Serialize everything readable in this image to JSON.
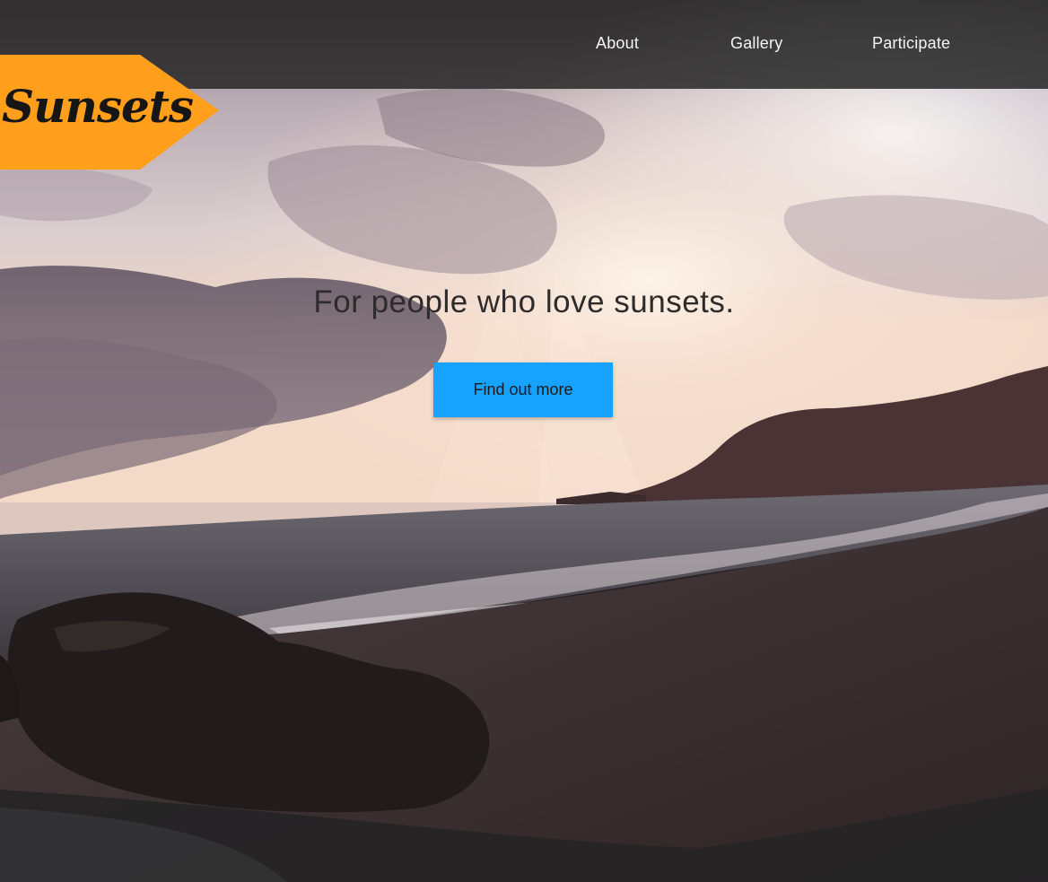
{
  "logo": {
    "text": "Sunsets"
  },
  "nav": {
    "items": [
      {
        "label": "About"
      },
      {
        "label": "Gallery"
      },
      {
        "label": "Participate"
      }
    ]
  },
  "hero": {
    "headline": "For people who love sunsets.",
    "cta_label": "Find out more",
    "image_subject": "sunset over a beach with rocks and sea"
  },
  "colors": {
    "header_bg": "#282828",
    "logo_badge": "#ff9f1c",
    "cta_bg": "#17a2ff",
    "headline_text": "#2f2b2b"
  }
}
